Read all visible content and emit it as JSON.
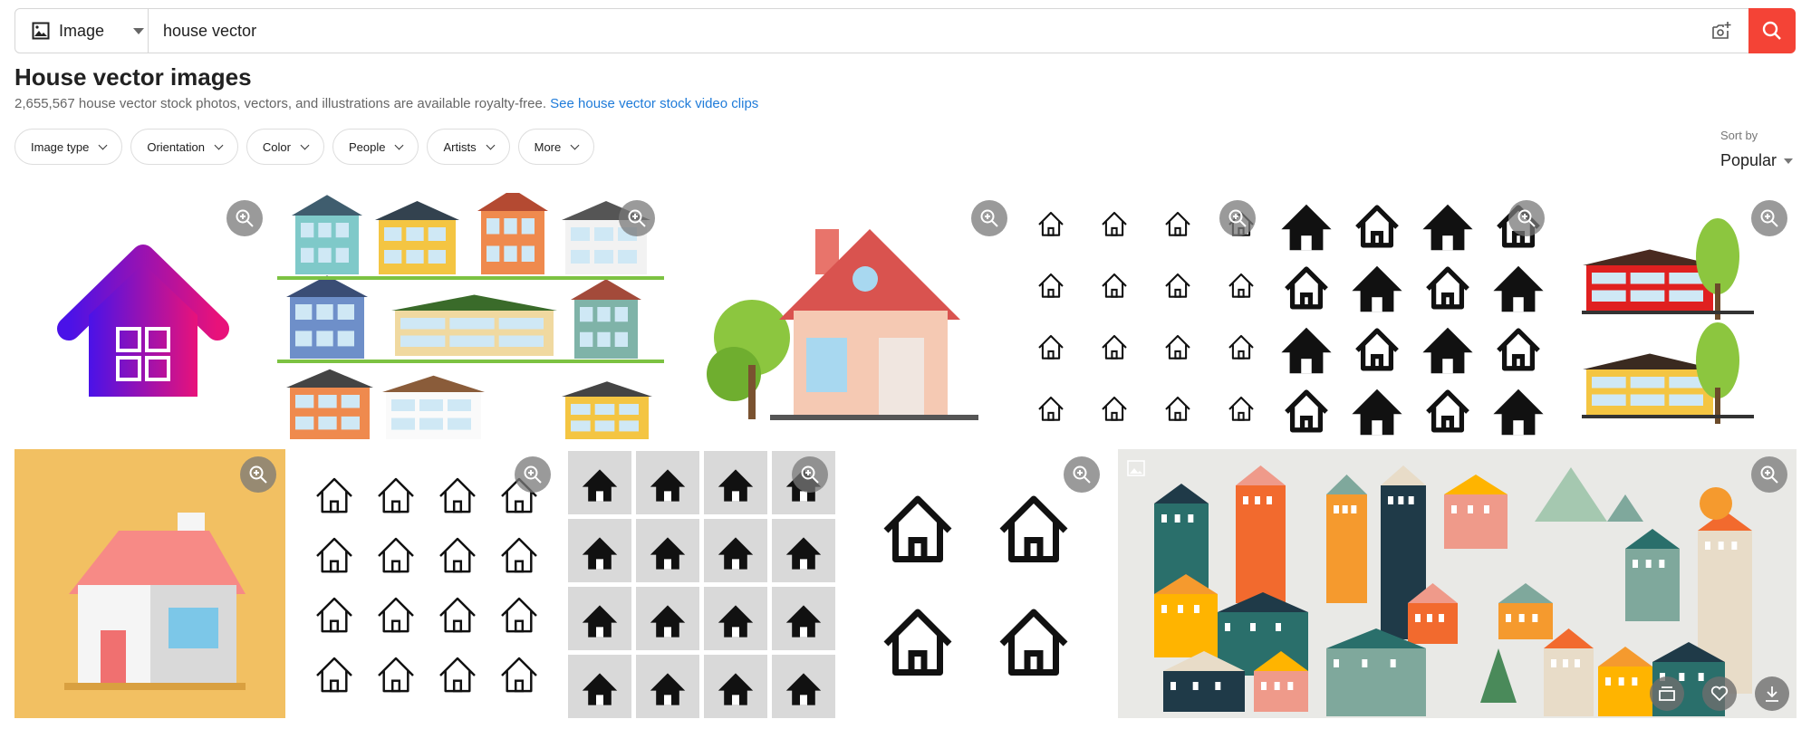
{
  "search": {
    "type_label": "Image",
    "query": "house vector",
    "camera_icon": "camera-plus-icon",
    "search_icon": "search-icon",
    "accent_color": "#f44336"
  },
  "header": {
    "title": "House vector images",
    "subtitle": "2,655,567 house vector stock photos, vectors, and illustrations are available royalty-free.",
    "video_link": "See house vector stock video clips"
  },
  "filters": [
    "Image type",
    "Orientation",
    "Color",
    "People",
    "Artists",
    "More"
  ],
  "sort": {
    "label": "Sort by",
    "value": "Popular"
  },
  "results": {
    "row1": [
      "gradient house icon",
      "set of colorful houses",
      "cartoon house with tree",
      "line house icon set",
      "black house icon set",
      "two houses with trees"
    ],
    "row2": [
      "3d house on orange background",
      "outline house icons",
      "house icons on gray squares",
      "four outline house icons",
      "scandinavian houses collection"
    ],
    "actions": [
      "similar-icon",
      "heart-icon",
      "download-icon"
    ]
  }
}
